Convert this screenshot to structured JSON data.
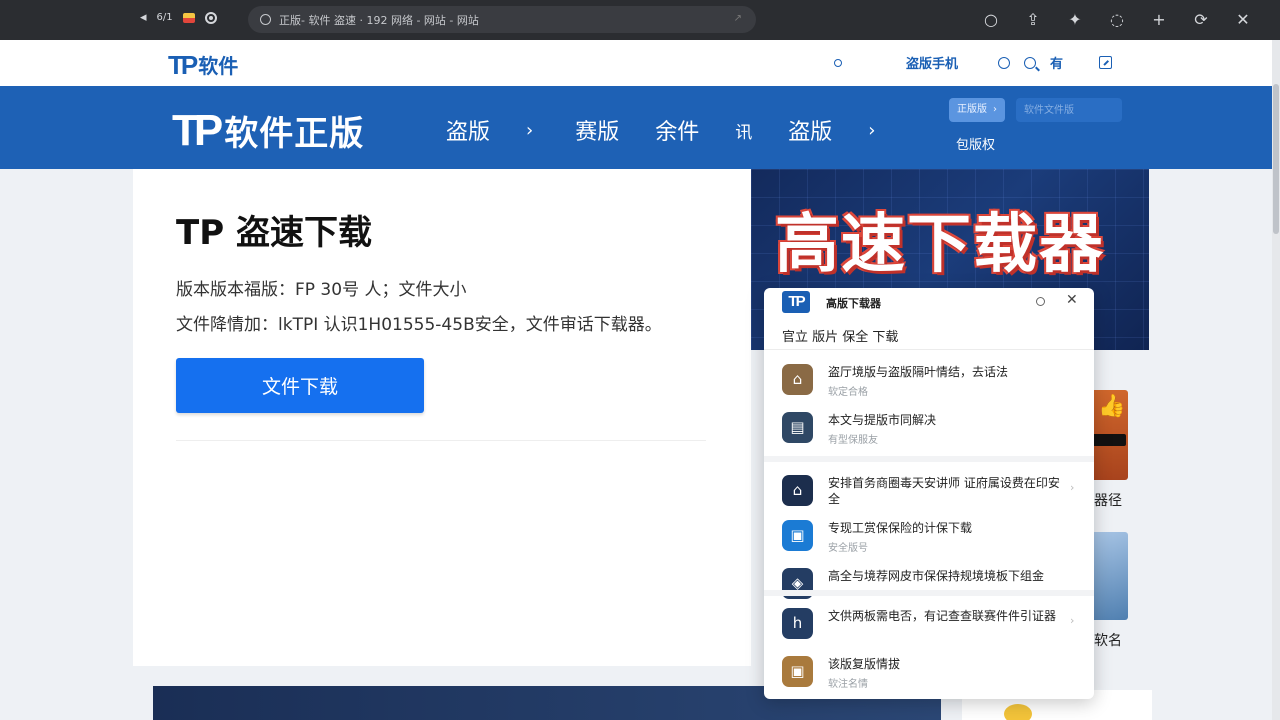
{
  "browser": {
    "tab_text": "6/1",
    "url": "正版- 软件 盗速 · 192 网络 - 网站 - 网站",
    "back_glyph": "◂"
  },
  "topbar": {
    "logo_mark": "TP",
    "logo_text": "软件",
    "link_mobile": "盗版手机",
    "link_have": "有"
  },
  "band": {
    "logo_mark": "TP",
    "title": "软件正版",
    "menu": [
      "盗版",
      "赛版",
      "余件",
      "讯",
      "盗版"
    ],
    "tag_text": "正版版",
    "tag_arrow": "›",
    "search_placeholder": "软件文件版",
    "sub_link": "包版权"
  },
  "main": {
    "title": "TP 盗速下载",
    "info_1": "版本版本福版：FP 30号  人；文件大小",
    "info_2": "文件降情加：lkTPI 认识1H01555-45B安全，文件审话下载器。",
    "download_label": "文件下载"
  },
  "banner": {
    "title": "高速下载器"
  },
  "side": {
    "label_1": "器径",
    "label_2": "软名"
  },
  "popup": {
    "logo_mark": "TP",
    "title": "高版下载器",
    "subtitle": "官立  版片 保全 下载",
    "close_glyph": "✕",
    "items": [
      {
        "icon": "home-icon",
        "glyph": "⌂",
        "color": "#8a6a45",
        "title": "盗厅境版与盗版隔叶情结，去话法",
        "sub": "软定合格"
      },
      {
        "icon": "document-icon",
        "glyph": "▤",
        "color": "#2f4865",
        "title": "本文与提版市同解决",
        "sub": "有型保服友"
      },
      {
        "icon": "house-icon",
        "glyph": "⌂",
        "color": "#1c2e4d",
        "title": "安排首务商圈毒天安讲师 证府属设费在印安全",
        "sub": ""
      },
      {
        "icon": "package-icon",
        "glyph": "▣",
        "color": "#1b7bd4",
        "title": "专现工赏保保险的计保下载",
        "sub": "安全版号"
      },
      {
        "icon": "shield-icon",
        "glyph": "◈",
        "color": "#243d63",
        "title": "高全与境荐网皮市保保持规境境板下组金",
        "sub": ""
      },
      {
        "icon": "hotel-icon",
        "glyph": "h",
        "color": "#243d63",
        "title": "文供两板需电否，有记查查联赛件件引证器",
        "sub": ""
      },
      {
        "icon": "box-icon",
        "glyph": "▣",
        "color": "#a97a3d",
        "title": "该版复版情拔",
        "sub": "软注名情"
      }
    ]
  }
}
